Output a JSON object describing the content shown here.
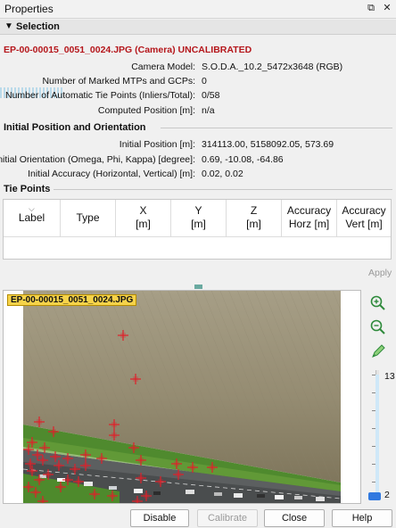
{
  "window": {
    "title": "Properties",
    "float_icon": "float-icon",
    "close_icon": "close-icon"
  },
  "selection": {
    "header": "Selection",
    "camera_title": "EP-00-00015_0051_0024.JPG (Camera) UNCALIBRATED",
    "rows": [
      {
        "label": "Camera Model:",
        "value": "S.O.D.A._10.2_5472x3648 (RGB)"
      },
      {
        "label": "Number of Marked MTPs and GCPs:",
        "value": "0"
      },
      {
        "label": "Number of Automatic Tie Points (Inliers/Total):",
        "value": "0/58"
      },
      {
        "label": "Computed Position [m]:",
        "value": "n/a"
      }
    ]
  },
  "initial": {
    "header": "Initial Position and Orientation",
    "rows": [
      {
        "label": "Initial Position [m]:",
        "value": "314113.00, 5158092.05, 573.69"
      },
      {
        "label": "Initial Orientation (Omega, Phi, Kappa) [degree]:",
        "value": "0.69, -10.08, -64.86"
      },
      {
        "label": "Initial Accuracy (Horizontal, Vertical) [m]:",
        "value": "0.02, 0.02"
      }
    ]
  },
  "tie_points": {
    "header": "Tie Points",
    "columns": [
      {
        "line1": "Label",
        "line2": ""
      },
      {
        "line1": "Type",
        "line2": ""
      },
      {
        "line1": "X",
        "line2": "[m]"
      },
      {
        "line1": "Y",
        "line2": "[m]"
      },
      {
        "line1": "Z",
        "line2": "[m]"
      },
      {
        "line1": "Accuracy",
        "line2": "Horz [m]"
      },
      {
        "line1": "Accuracy",
        "line2": "Vert [m]"
      }
    ]
  },
  "apply_label": "Apply",
  "viewer": {
    "image_label": "EP-00-00015_0051_0024.JPG",
    "zoom_in_icon": "zoom-in-icon",
    "zoom_out_icon": "zoom-out-icon",
    "pencil_icon": "pencil-icon",
    "slider_max": "13",
    "slider_min": "2",
    "slider_value": 2,
    "marker_color": "#e0202a"
  },
  "buttons": {
    "disable": "Disable",
    "calibrate": "Calibrate",
    "close": "Close",
    "help": "Help"
  }
}
